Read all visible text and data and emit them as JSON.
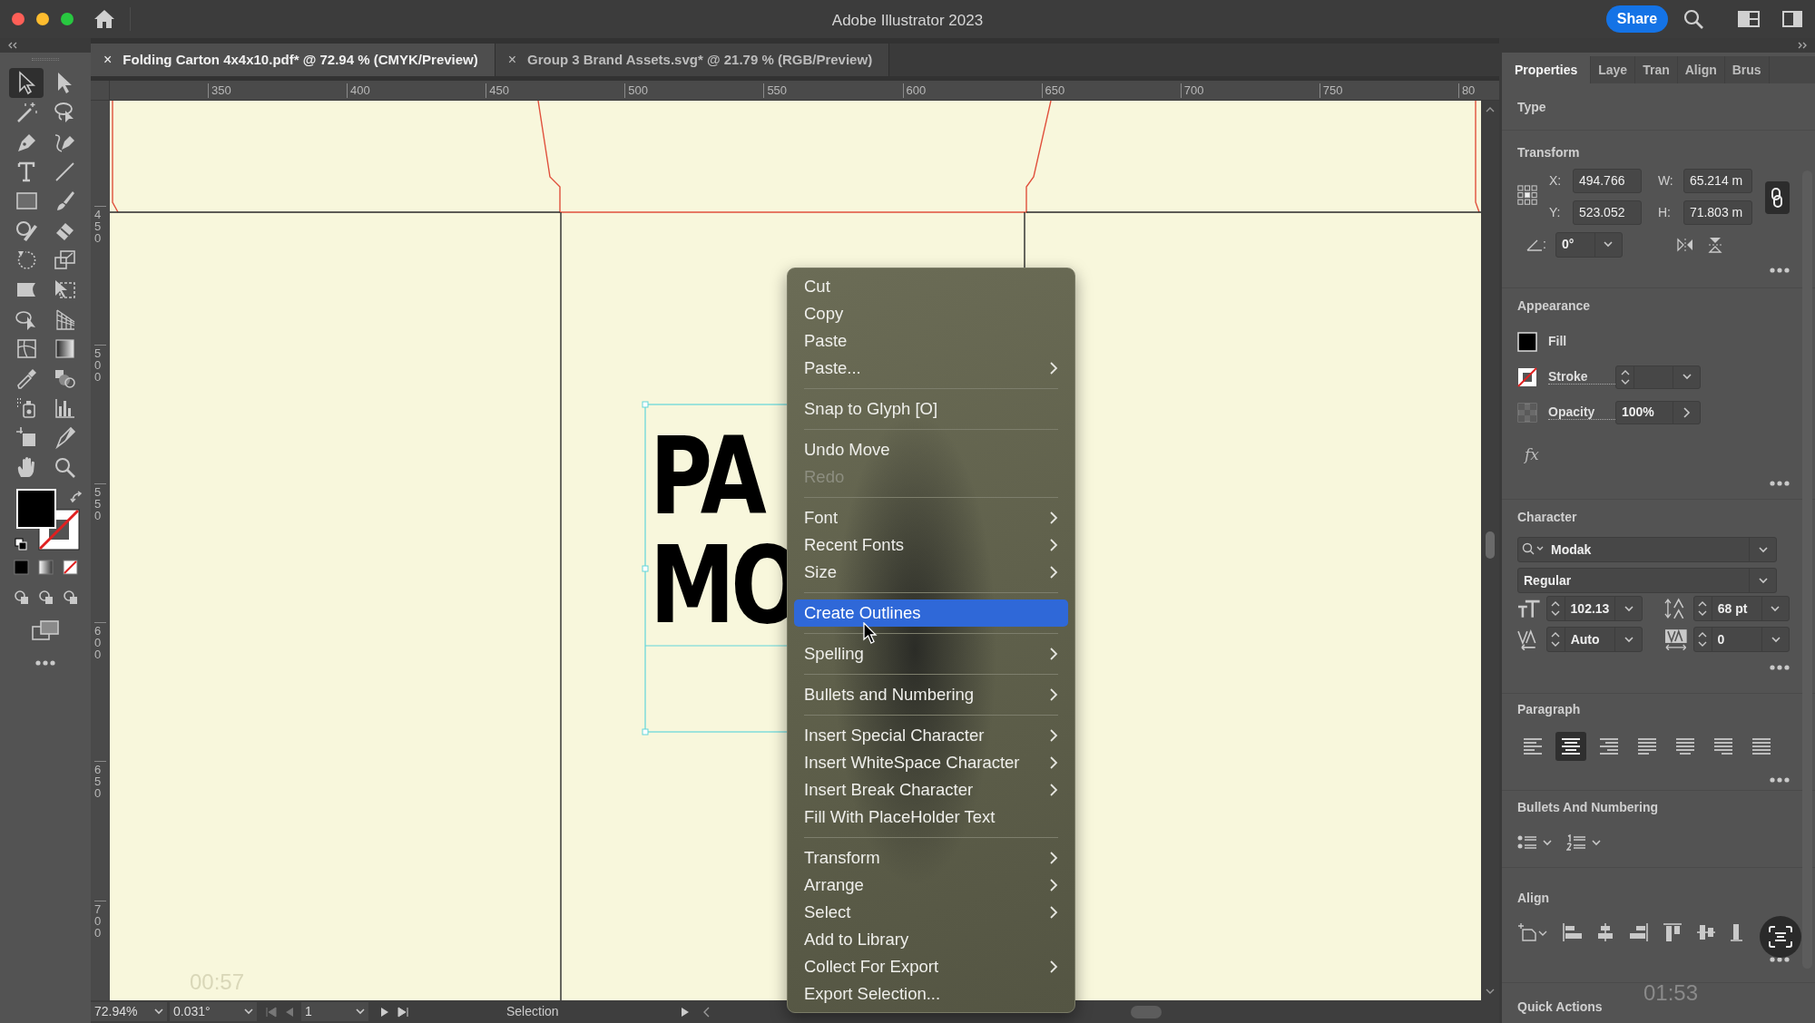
{
  "title_bar": {
    "title": "Adobe Illustrator 2023",
    "share_button": "Share"
  },
  "document_tabs": [
    {
      "close": "×",
      "label": "Folding Carton 4x4x10.pdf* @ 72.94 % (CMYK/Preview)",
      "selected": true
    },
    {
      "close": "×",
      "label": "Group 3 Brand Assets.svg* @ 21.79 % (RGB/Preview)",
      "selected": false
    }
  ],
  "tools": [
    {
      "selected": true
    },
    {
      "selected": false
    },
    {
      "selected": false
    },
    {
      "selected": false
    },
    {
      "selected": false
    },
    {
      "selected": false
    },
    {
      "selected": false
    },
    {
      "selected": false
    },
    {
      "selected": false
    },
    {
      "selected": false
    },
    {
      "selected": false
    },
    {
      "selected": false
    },
    {
      "selected": false
    },
    {
      "selected": false
    },
    {
      "selected": false
    },
    {
      "selected": false
    },
    {
      "selected": false
    },
    {
      "selected": false
    },
    {
      "selected": false
    },
    {
      "selected": false
    },
    {
      "selected": false
    },
    {
      "selected": false
    },
    {
      "selected": false
    },
    {
      "selected": false
    },
    {
      "selected": false
    },
    {
      "selected": false
    },
    {
      "selected": false
    },
    {
      "selected": false
    }
  ],
  "rulers": {
    "horizontal": [
      "350",
      "400",
      "450",
      "500",
      "550",
      "600",
      "650",
      "700",
      "750",
      "80"
    ],
    "vertical": [
      "450",
      "500",
      "550",
      "600",
      "650",
      "700"
    ]
  },
  "canvas": {
    "text_lines": [
      "PA",
      "MO"
    ]
  },
  "context_menu": {
    "items": [
      {
        "kind": "command",
        "label": "Cut",
        "submenu": false,
        "disabled": false,
        "selected": false
      },
      {
        "kind": "command",
        "label": "Copy",
        "submenu": false,
        "disabled": false,
        "selected": false
      },
      {
        "kind": "command",
        "label": "Paste",
        "submenu": false,
        "disabled": false,
        "selected": false
      },
      {
        "kind": "command",
        "label": "Paste...",
        "submenu": true,
        "disabled": false,
        "selected": false
      },
      {
        "kind": "separator"
      },
      {
        "kind": "command",
        "label": "Snap to Glyph [O]",
        "submenu": false,
        "disabled": false,
        "selected": false
      },
      {
        "kind": "separator"
      },
      {
        "kind": "command",
        "label": "Undo Move",
        "submenu": false,
        "disabled": false,
        "selected": false
      },
      {
        "kind": "command",
        "label": "Redo",
        "submenu": false,
        "disabled": true,
        "selected": false
      },
      {
        "kind": "separator"
      },
      {
        "kind": "command",
        "label": "Font",
        "submenu": true,
        "disabled": false,
        "selected": false
      },
      {
        "kind": "command",
        "label": "Recent Fonts",
        "submenu": true,
        "disabled": false,
        "selected": false
      },
      {
        "kind": "command",
        "label": "Size",
        "submenu": true,
        "disabled": false,
        "selected": false
      },
      {
        "kind": "separator"
      },
      {
        "kind": "command",
        "label": "Create Outlines",
        "submenu": false,
        "disabled": false,
        "selected": true
      },
      {
        "kind": "separator"
      },
      {
        "kind": "command",
        "label": "Spelling",
        "submenu": true,
        "disabled": false,
        "selected": false
      },
      {
        "kind": "separator"
      },
      {
        "kind": "command",
        "label": "Bullets and Numbering",
        "submenu": true,
        "disabled": false,
        "selected": false
      },
      {
        "kind": "separator"
      },
      {
        "kind": "command",
        "label": "Insert Special Character",
        "submenu": true,
        "disabled": false,
        "selected": false
      },
      {
        "kind": "command",
        "label": "Insert WhiteSpace Character",
        "submenu": true,
        "disabled": false,
        "selected": false
      },
      {
        "kind": "command",
        "label": "Insert Break Character",
        "submenu": true,
        "disabled": false,
        "selected": false
      },
      {
        "kind": "command",
        "label": "Fill With PlaceHolder Text",
        "submenu": false,
        "disabled": false,
        "selected": false
      },
      {
        "kind": "separator"
      },
      {
        "kind": "command",
        "label": "Transform",
        "submenu": true,
        "disabled": false,
        "selected": false
      },
      {
        "kind": "command",
        "label": "Arrange",
        "submenu": true,
        "disabled": false,
        "selected": false
      },
      {
        "kind": "command",
        "label": "Select",
        "submenu": true,
        "disabled": false,
        "selected": false
      },
      {
        "kind": "command",
        "label": "Add to Library",
        "submenu": false,
        "disabled": false,
        "selected": false
      },
      {
        "kind": "command",
        "label": "Collect For Export",
        "submenu": true,
        "disabled": false,
        "selected": false
      },
      {
        "kind": "command",
        "label": "Export Selection...",
        "submenu": false,
        "disabled": false,
        "selected": false
      }
    ]
  },
  "status_bar": {
    "zoom": "72.94%",
    "rotation": "0.031°",
    "artboard": "1",
    "tool": "Selection"
  },
  "properties_panel": {
    "tabs": [
      {
        "label": "Properties",
        "selected": true
      },
      {
        "label": "Laye",
        "selected": false
      },
      {
        "label": "Tran",
        "selected": false
      },
      {
        "label": "Align",
        "selected": false
      },
      {
        "label": "Brus",
        "selected": false
      }
    ],
    "type_heading": "Type",
    "transform": {
      "heading": "Transform",
      "fields": [
        {
          "label": "X:",
          "value": "494.766"
        },
        {
          "label": "W:",
          "value": "65.214 m"
        },
        {
          "label": "Y:",
          "value": "523.052"
        },
        {
          "label": "H:",
          "value": "71.803 m"
        }
      ],
      "proportions_linked": true,
      "angle": {
        "label": ":",
        "value": "0°"
      }
    },
    "appearance": {
      "heading": "Appearance",
      "fill": "Fill",
      "stroke": "Stroke",
      "opacity_label": "Opacity",
      "opacity": "100%",
      "effects": "fx"
    },
    "character": {
      "heading": "Character",
      "font": "Modak",
      "style": "Regular",
      "size": "102.13",
      "leading": "68 pt",
      "kerning": "Auto",
      "tracking": "0"
    },
    "paragraph": {
      "heading": "Paragraph",
      "alignments": [
        {
          "selected": false
        },
        {
          "selected": true
        },
        {
          "selected": false
        },
        {
          "selected": false
        },
        {
          "selected": false
        },
        {
          "selected": false
        },
        {
          "selected": false
        }
      ]
    },
    "bullets": {
      "heading": "Bullets And Numbering"
    },
    "align": {
      "heading": "Align"
    },
    "quick_actions": {
      "heading": "Quick Actions"
    }
  },
  "video_overlay": {
    "elapsed": "00:57",
    "remaining": "01:53"
  }
}
